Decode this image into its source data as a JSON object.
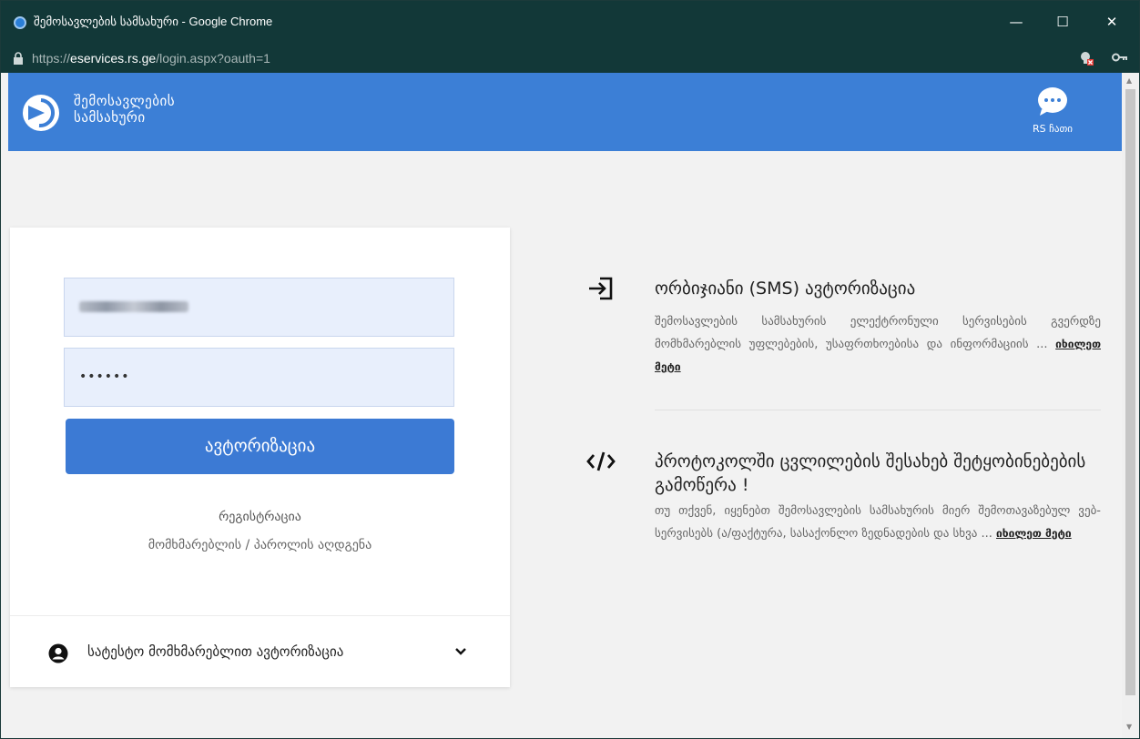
{
  "browser": {
    "title": "შემოსავლების სამსახური - Google Chrome",
    "url_scheme": "https://",
    "url_domain": "eservices.rs.ge",
    "url_path": "/login.aspx?oauth=1",
    "minimize": "—",
    "maximize": "☐",
    "close": "✕"
  },
  "header": {
    "logo_line1": "შემოსავლების",
    "logo_line2": "სამსახური",
    "chat_label": "RS ჩათი",
    "accent": "#3c7fd6"
  },
  "login": {
    "username_value": "",
    "password_value": "••••••",
    "submit_label": "ავტორიზაცია",
    "register_link": "რეგისტრაცია",
    "recover_link": "მომხმარებლის / პაროლის აღდგენა",
    "test_user_label": "სატესტო მომხმარებლით ავტორიზაცია"
  },
  "info": {
    "sms": {
      "icon": "login-arrow-icon",
      "title": "ორბიჯიანი (SMS) ავტორიზაცია",
      "text": "შემოსავლების სამსახურის ელექტრონული სერვისების გვერდზე მომხმარებლის უფლებების, უსაფრთხოებისა და ინფორმაციის ...",
      "more": "იხილეთ მეტი"
    },
    "protocol": {
      "icon": "code-icon",
      "title": "პროტოკოლში ცვლილების შესახებ შეტყობინებების გამოწერა !",
      "text": "თუ თქვენ, იყენებთ შემოსავლების სამსახურის მიერ შემოთავაზებულ ვებ-სერვისებს (ა/ფაქტურა, სასაქონლო ზედნადების და სხვა ...",
      "more": "იხილეთ მეტი"
    }
  }
}
